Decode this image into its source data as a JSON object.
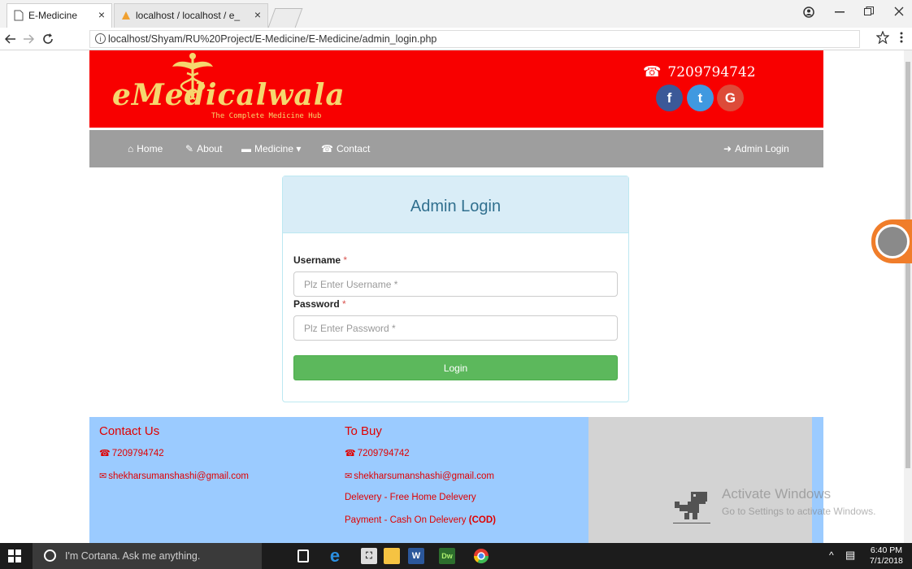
{
  "browser": {
    "tabs": [
      {
        "title": "E-Medicine"
      },
      {
        "title": "localhost / localhost / e_"
      }
    ],
    "url": "localhost/Shyam/RU%20Project/E-Medicine/E-Medicine/admin_login.php",
    "close_glyph": "×"
  },
  "header": {
    "logo_text": "eMedicalwala",
    "logo_tagline": "The Complete Medicine Hub",
    "phone": "7209794742",
    "social": [
      {
        "label": "f",
        "icon": "facebook-icon",
        "color": "#3b5998"
      },
      {
        "label": "t",
        "icon": "twitter-icon",
        "color": "#4099e0"
      },
      {
        "label": "G",
        "icon": "google-plus-icon",
        "color": "#dd4b39"
      }
    ],
    "bg_color": "#f80000"
  },
  "nav": {
    "home": "Home",
    "about": "About",
    "medicine": "Medicine",
    "contact": "Contact",
    "admin_login": "Admin Login"
  },
  "login": {
    "title": "Admin Login",
    "username_label": "Username",
    "username_placeholder": "Plz Enter Username *",
    "password_label": "Password",
    "password_placeholder": "Plz Enter Password *",
    "required_mark": "*",
    "button": "Login",
    "button_color": "#5cb85c"
  },
  "footer": {
    "contact": {
      "title": "Contact Us",
      "phone": "7209794742",
      "email": "shekharsumanshashi@gmail.com"
    },
    "buy": {
      "title": "To Buy",
      "phone": "7209794742",
      "email": "shekharsumanshashi@gmail.com",
      "delivery": "Delevery - Free Home Delevery",
      "payment": "Payment - Cash On Delevery",
      "payment_code": "(COD)"
    }
  },
  "watermark": {
    "line1": "Activate Windows",
    "line2": "Go to Settings to activate Windows."
  },
  "taskbar": {
    "search_placeholder": "I'm Cortana. Ask me anything.",
    "time": "6:40 PM",
    "date": "7/1/2018"
  }
}
